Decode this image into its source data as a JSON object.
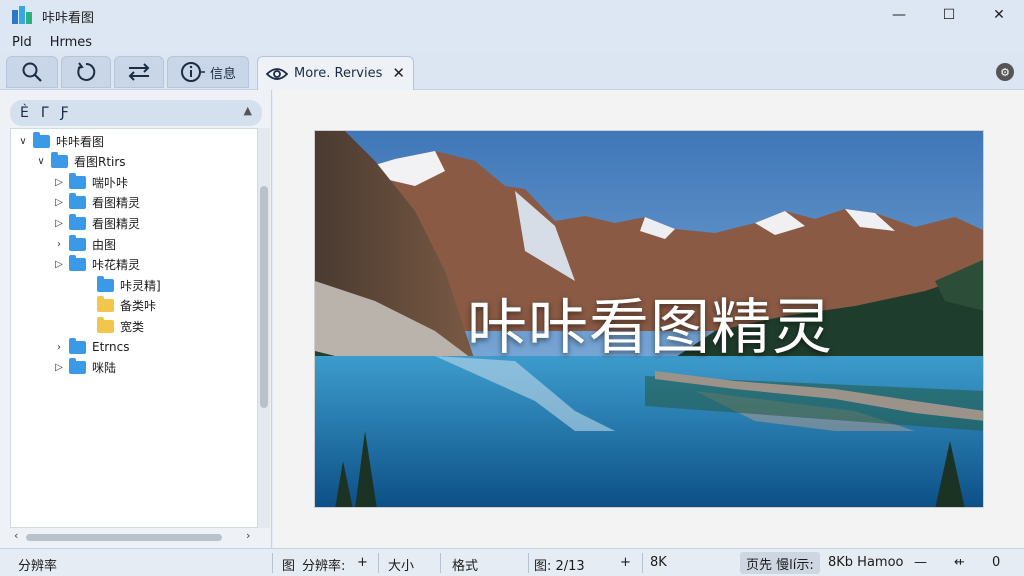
{
  "window": {
    "title": "咔咔看图",
    "controls": {
      "minimize": "—",
      "maximize": "☐",
      "close": "✕"
    }
  },
  "menu": [
    "Pld",
    "Hrmes"
  ],
  "toolbar": {
    "buttons": [
      {
        "icon": "search-icon",
        "label": ""
      },
      {
        "icon": "refresh-icon",
        "label": ""
      },
      {
        "icon": "swap-icon",
        "label": ""
      },
      {
        "icon": "info-icon",
        "label": "信息"
      }
    ],
    "tab": {
      "label": "More. Rervies",
      "icon": "eye-icon",
      "close": "✕"
    }
  },
  "sidebar": {
    "header_icons": [
      "Ѐ",
      "ᒥ",
      "Ƒ"
    ],
    "tree": [
      {
        "label": "咔咔看图",
        "depth": 0,
        "arrow": "∨",
        "color": "blue"
      },
      {
        "label": "看图Rtirs",
        "depth": 1,
        "arrow": "∨",
        "color": "blue"
      },
      {
        "label": "喘卟咔",
        "depth": 2,
        "arrow": "▷",
        "color": "blue"
      },
      {
        "label": "看图精灵",
        "depth": 2,
        "arrow": "▷",
        "color": "blue"
      },
      {
        "label": "看图精灵",
        "depth": 2,
        "arrow": "▷",
        "color": "blue"
      },
      {
        "label": "由图",
        "depth": 2,
        "arrow": "›",
        "color": "blue"
      },
      {
        "label": "咔花精灵",
        "depth": 2,
        "arrow": "▷",
        "color": "blue"
      },
      {
        "label": "咔灵精]",
        "depth": 3,
        "arrow": "",
        "color": "blue"
      },
      {
        "label": "备类咔",
        "depth": 3,
        "arrow": "",
        "color": "yellow"
      },
      {
        "label": "宽类",
        "depth": 3,
        "arrow": "",
        "color": "yellow"
      },
      {
        "label": "Etrncs",
        "depth": 2,
        "arrow": "›",
        "color": "blue"
      },
      {
        "label": "咪陆",
        "depth": 2,
        "arrow": "▷",
        "color": "blue"
      }
    ]
  },
  "viewer": {
    "caption": "咔咔看图精灵"
  },
  "status": {
    "left": "分辨率",
    "img": "图",
    "resolution": "分辨率:",
    "plus1": "+",
    "size": "大小",
    "format": "格式",
    "page": "图: 2/13",
    "plus2": "+",
    "quality": "8K",
    "chip": "页先  慢lí示:",
    "zoom": "8Kb  Hamoo",
    "minus": "—",
    "fit": "⇷",
    "rotate": "0"
  },
  "colors": {
    "accent": "#3b9ae8",
    "folder_yellow": "#f2c54b"
  }
}
